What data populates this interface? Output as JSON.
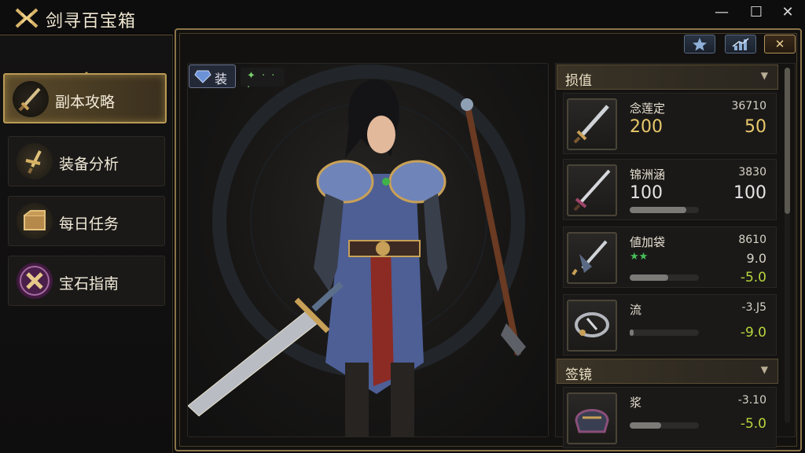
{
  "app": {
    "title": "剑寻百宝箱"
  },
  "window": {
    "minimize": "—",
    "maximize": "☐",
    "close": "✕"
  },
  "nav": {
    "items": [
      {
        "label": "副本攻略",
        "icon": "sword-icon",
        "active": true
      },
      {
        "label": "装备分析",
        "icon": "dagger-icon",
        "active": false
      },
      {
        "label": "每日任务",
        "icon": "chest-icon",
        "active": false
      },
      {
        "label": "宝石指南",
        "icon": "gem-icon",
        "active": false
      }
    ]
  },
  "toolbar": {
    "favorite_icon": "star-icon",
    "stats_icon": "chart-icon",
    "close_label": "✕"
  },
  "character": {
    "tab_label": "装",
    "sub_text": "✦ · · ·"
  },
  "sections": [
    {
      "title": "损值",
      "items": [
        {
          "name": "念莲定",
          "sub": "36710",
          "left": "200",
          "right": "50",
          "icon": "longsword-icon"
        },
        {
          "name": "锦洲涵",
          "sub": "3830",
          "left": "100",
          "right": "100",
          "icon": "spear-sword-icon",
          "bar": 0.82
        },
        {
          "name": "値加袋",
          "sub": "8610",
          "stars": "★★",
          "mid": "9.0",
          "delta": "-5.0",
          "icon": "trident-icon",
          "bar": 0.56
        },
        {
          "name": "流",
          "sub": "-3.J5",
          "delta": "-9.0",
          "icon": "ring-icon",
          "bar": 0.06
        }
      ]
    },
    {
      "title": "签镜",
      "items": [
        {
          "name": "浆",
          "sub": "-3.10",
          "delta": "-5.0",
          "icon": "helmet-icon",
          "bar": 0.46
        }
      ]
    }
  ],
  "colors": {
    "accent": "#b99a56",
    "positive": "#b8d63c",
    "value_gold": "#e8c86a"
  }
}
